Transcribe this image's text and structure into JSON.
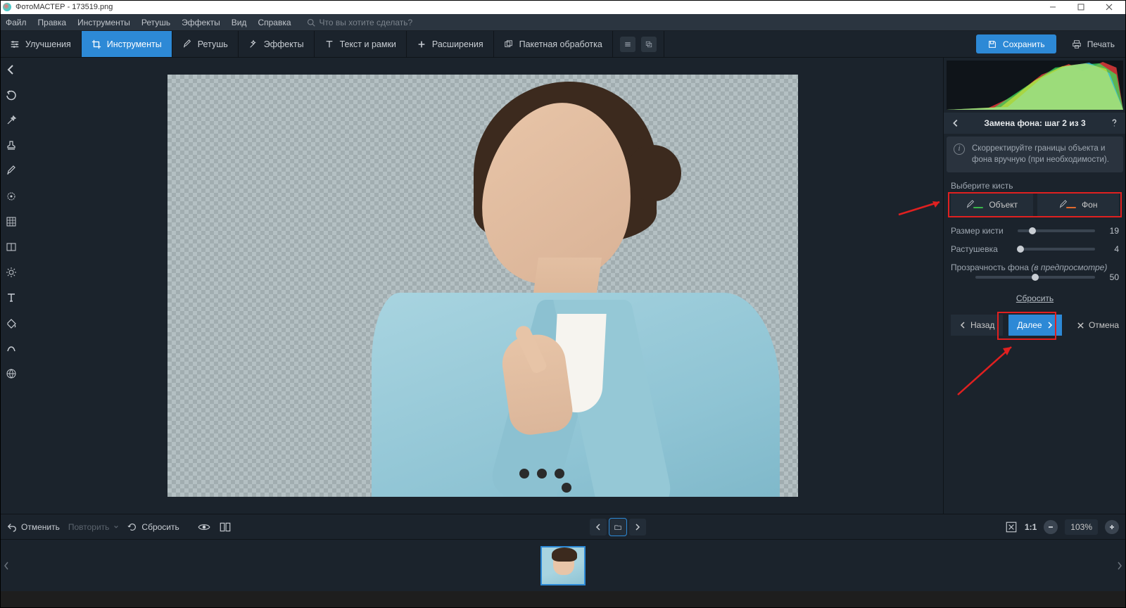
{
  "titlebar": {
    "app": "ФотоМАСТЕР",
    "filename": "173519.png"
  },
  "menubar": {
    "items": [
      "Файл",
      "Правка",
      "Инструменты",
      "Ретушь",
      "Эффекты",
      "Вид",
      "Справка"
    ],
    "search_placeholder": "Что вы хотите сделать?"
  },
  "toolbar": {
    "tabs": [
      {
        "label": "Улучшения",
        "icon": "sliders-icon"
      },
      {
        "label": "Инструменты",
        "icon": "crop-icon",
        "active": true
      },
      {
        "label": "Ретушь",
        "icon": "brush-icon"
      },
      {
        "label": "Эффекты",
        "icon": "wand-icon"
      },
      {
        "label": "Текст и рамки",
        "icon": "text-icon"
      },
      {
        "label": "Расширения",
        "icon": "plus-icon"
      },
      {
        "label": "Пакетная обработка",
        "icon": "batch-icon"
      }
    ],
    "save": "Сохранить",
    "print": "Печать"
  },
  "vtool_icons": [
    "back-arrow",
    "redo",
    "magic-wand",
    "stamp",
    "brush",
    "target",
    "grid",
    "compare",
    "brightness",
    "text-t",
    "bucket",
    "omega",
    "globe"
  ],
  "rpanel": {
    "title": "Замена фона: шаг 2 из 3",
    "hint": "Скорректируйте границы объекта и фона вручную (при необходимости).",
    "brush_label": "Выберите кисть",
    "brush_object": "Объект",
    "brush_bg": "Фон",
    "sliders": {
      "size": {
        "label": "Размер кисти",
        "value": 19,
        "max": 100
      },
      "feather": {
        "label": "Растушевка",
        "value": 4,
        "max": 100
      },
      "opacity": {
        "label": "Прозрачность фона",
        "note": "(в предпросмотре)",
        "value": 50,
        "max": 100
      }
    },
    "reset": "Сбросить",
    "nav": {
      "back": "Назад",
      "next": "Далее",
      "cancel": "Отмена"
    },
    "colors": {
      "object_stroke": "#3ab54a",
      "bg_stroke": "#e06a2f"
    }
  },
  "statusbar": {
    "undo": "Отменить",
    "redo": "Повторить",
    "reset": "Сбросить",
    "zoom": "103%",
    "oneToOne": "1:1"
  }
}
